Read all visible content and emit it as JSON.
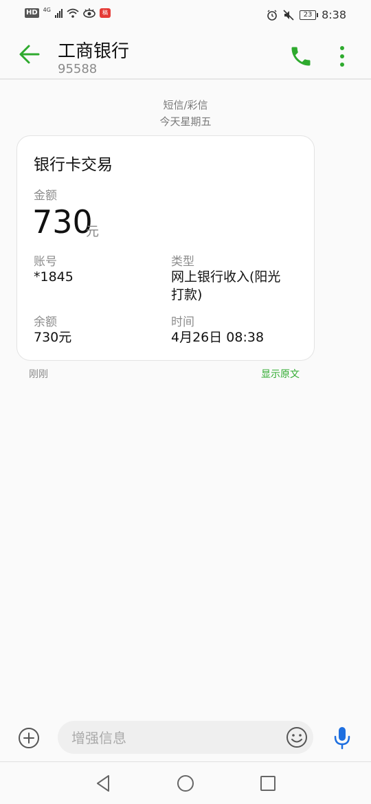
{
  "status": {
    "hd": "HD",
    "network": "4G",
    "app_badge": "稿",
    "battery": "23",
    "time": "8:38"
  },
  "header": {
    "title": "工商银行",
    "number": "95588"
  },
  "thread": {
    "channel": "短信/彩信",
    "day": "今天星期五"
  },
  "card": {
    "title": "银行卡交易",
    "amount_label": "金额",
    "amount": "730",
    "amount_unit": "元",
    "account_label": "账号",
    "account": "*1845",
    "type_label": "类型",
    "type_line1": "网上银行收入(阳光",
    "type_line2": "打款)",
    "balance_label": "余额",
    "balance": "730元",
    "time_label": "时间",
    "time": "4月26日 08:38"
  },
  "message_footer": {
    "time_ago": "刚刚",
    "show_original": "显示原文"
  },
  "composer": {
    "placeholder": "增强信息"
  },
  "colors": {
    "accent": "#2eaa2e",
    "mic": "#1e6fe0"
  }
}
